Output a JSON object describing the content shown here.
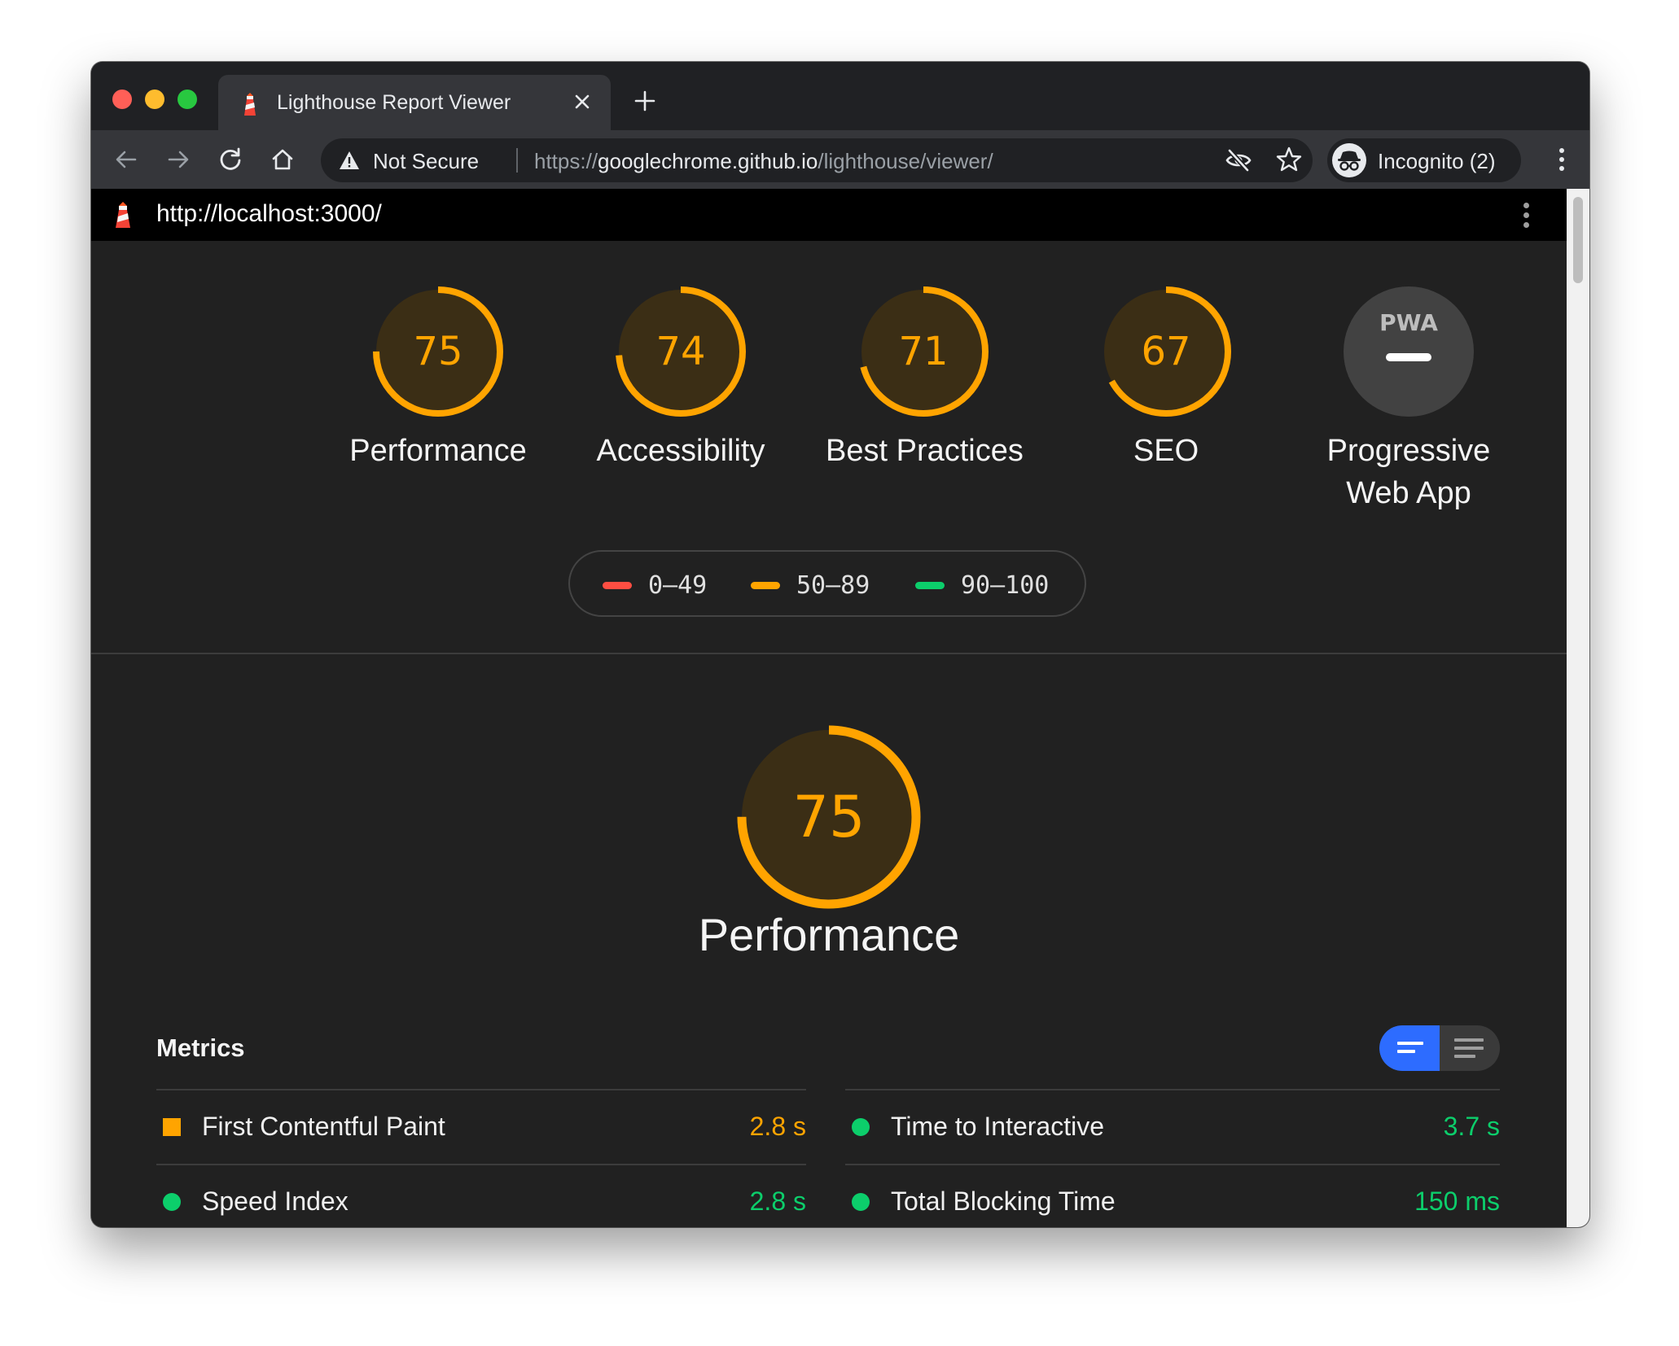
{
  "browser": {
    "tab": {
      "title": "Lighthouse Report Viewer"
    },
    "omnibox": {
      "security_label": "Not Secure",
      "url_scheme": "https://",
      "url_host": "googlechrome.github.io",
      "url_path": "/lighthouse/viewer/"
    },
    "profile": {
      "label": "Incognito (2)"
    }
  },
  "report": {
    "topbar_url": "http://localhost:3000/",
    "categories": [
      {
        "label": "Performance",
        "score": "75",
        "fraction": 0.75
      },
      {
        "label": "Accessibility",
        "score": "74",
        "fraction": 0.74
      },
      {
        "label": "Best Practices",
        "score": "71",
        "fraction": 0.71
      },
      {
        "label": "SEO",
        "score": "67",
        "fraction": 0.67
      },
      {
        "label": "Progressive Web App",
        "badge_text": "PWA"
      }
    ],
    "legend": [
      {
        "range": "0–49",
        "color": "#ff4e42"
      },
      {
        "range": "50–89",
        "color": "#ffa400"
      },
      {
        "range": "90–100",
        "color": "#0cce6b"
      }
    ],
    "section": {
      "label": "Performance",
      "score": "75",
      "fraction": 0.75
    },
    "metrics_title": "Metrics",
    "metrics": [
      {
        "label": "First Contentful Paint",
        "value": "2.8 s",
        "status": "average"
      },
      {
        "label": "Time to Interactive",
        "value": "3.7 s",
        "status": "pass"
      },
      {
        "label": "Speed Index",
        "value": "2.8 s",
        "status": "pass"
      },
      {
        "label": "Total Blocking Time",
        "value": "150 ms",
        "status": "pass"
      }
    ]
  },
  "colors": {
    "average": "#ffa400",
    "pass": "#0cce6b",
    "fail": "#ff4e42",
    "gauge_fill_average": "#3b2e15",
    "toggle_active": "#2d6cff"
  },
  "icons": [
    "lighthouse-icon",
    "close-icon",
    "plus-icon",
    "back-arrow-icon",
    "forward-arrow-icon",
    "reload-icon",
    "home-icon",
    "warning-icon",
    "eye-off-icon",
    "star-icon",
    "incognito-icon",
    "more-vert-icon",
    "pwa-icon",
    "minus-icon",
    "expanded-view-icon",
    "list-view-icon"
  ]
}
